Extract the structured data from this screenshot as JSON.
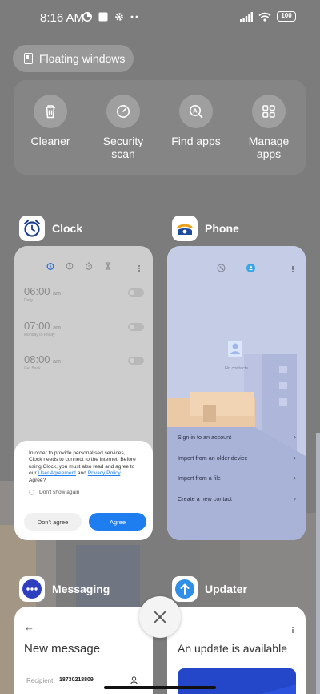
{
  "status_bar": {
    "time": "8:16 AM",
    "battery": "100"
  },
  "floating_windows": {
    "label": "Floating windows"
  },
  "quick_actions": [
    {
      "label": "Cleaner",
      "icon": "trash-icon"
    },
    {
      "label": "Security scan",
      "icon": "security-icon"
    },
    {
      "label": "Find apps",
      "icon": "find-apps-icon"
    },
    {
      "label": "Manage apps",
      "icon": "grid-icon"
    }
  ],
  "apps": {
    "clock": {
      "name": "Clock",
      "alarms": [
        {
          "time": "06:00",
          "ampm": "am",
          "sub": "Daily"
        },
        {
          "time": "07:00",
          "ampm": "am",
          "sub": "Monday to Friday"
        },
        {
          "time": "08:00",
          "ampm": "am",
          "sub": "Get Back"
        }
      ],
      "dialog": {
        "text": "In order to provide personalised services, Clock needs to connect to the internet. Before using Clock, you must also read and agree to our",
        "user_agreement": "User Agreement",
        "and": "and",
        "privacy_policy": "Privacy Policy",
        "agree_q": ". Agree?",
        "dont_show": "Don't show again",
        "dont_agree": "Don't agree",
        "agree": "Agree"
      }
    },
    "phone": {
      "name": "Phone",
      "no_contacts": "No contacts",
      "menu": [
        "Sign in to an account",
        "Import from an older device",
        "Import from a file",
        "Create a new contact"
      ]
    },
    "messaging": {
      "name": "Messaging",
      "title": "New message",
      "recipient_label": "Recipient:",
      "recipient_value": "18730218809"
    },
    "updater": {
      "name": "Updater",
      "title": "An update is available"
    }
  },
  "colors": {
    "accent": "#1e7ef0",
    "background": "#7d7d7d"
  }
}
